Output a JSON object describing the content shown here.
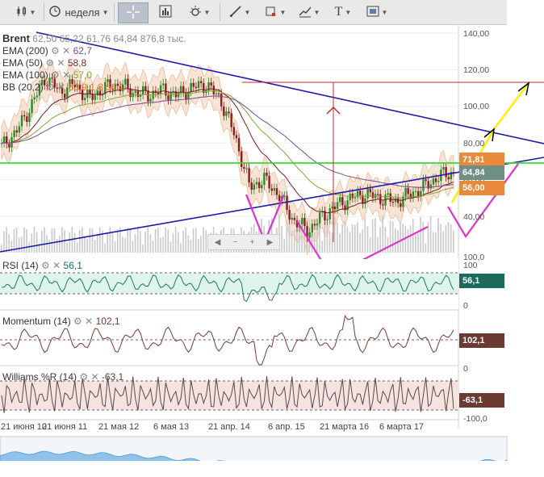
{
  "toolbar": {
    "chart_type_icon": "candlestick-icon",
    "period_label": "неделя",
    "crosshair_icon": "crosshair-icon",
    "chart_icon": "chart-icon",
    "indicators_icon": "indicators-icon",
    "draw_icon": "pencil-icon",
    "shapes_icon": "shapes-icon",
    "trendline_icon": "trendline-icon",
    "text_icon": "T",
    "template_icon": "template-icon"
  },
  "main": {
    "symbol": "Brent",
    "ohlc": [
      "62,50",
      "65,22",
      "61,76",
      "64,84"
    ],
    "volume": "876,8 тыс.",
    "indicators": [
      {
        "label": "EMA (200)",
        "value": "62,7",
        "color": "#7a4b90"
      },
      {
        "label": "EMA (50)",
        "value": "58,8",
        "color": "#8a1f1f"
      },
      {
        "label": "EMA (100)",
        "value": "57,0",
        "color": "#8aa23b"
      },
      {
        "label": "BB (20,2)",
        "value": "63,9",
        "extra": "1,8  56,0",
        "color": "#e07a2f"
      }
    ],
    "y_ticks": [
      "140,00",
      "120,00",
      "100,00",
      "80,00",
      "60,00",
      "40,00",
      "100,0"
    ],
    "badges": [
      "71,81",
      "64,84",
      "56,00"
    ],
    "badge_colors": [
      "#e88a3a",
      "#6f8f86",
      "#e88a3a"
    ]
  },
  "rsi": {
    "label": "RSI (14)",
    "value": "56,1",
    "ticks": [
      "100",
      "0"
    ],
    "badge": "56,1",
    "badge_color": "#1a6b5b"
  },
  "momentum": {
    "label": "Momentum (14)",
    "value": "102,1",
    "ticks": [
      "0"
    ],
    "badge": "102,1",
    "badge_color": "#6b3a33"
  },
  "williams": {
    "label": "Williams %R (14)",
    "value": "-63,1",
    "ticks": [
      "0",
      "-100,0"
    ],
    "badge": "-63,1",
    "badge_color": "#6b3a33"
  },
  "x_axis": [
    "21 июня 10",
    "21 июня 11",
    "21 мая 12",
    "6 мая 13",
    "21 апр. 14",
    "6 апр. 15",
    "21 марта 16",
    "6 марта 17"
  ],
  "navigator": {
    "label": ""
  },
  "chart_data": {
    "type": "line",
    "title": "Brent",
    "series": [
      {
        "name": "Brent",
        "values": [
          78,
          86,
          100,
          116,
          108,
          112,
          104,
          110,
          112,
          108,
          106,
          109,
          106,
          110,
          112,
          104,
          84,
          56,
          60,
          52,
          38,
          32,
          40,
          46,
          50,
          52,
          50,
          48,
          52,
          56,
          62,
          64
        ]
      }
    ],
    "ylim": [
      20,
      140
    ]
  }
}
